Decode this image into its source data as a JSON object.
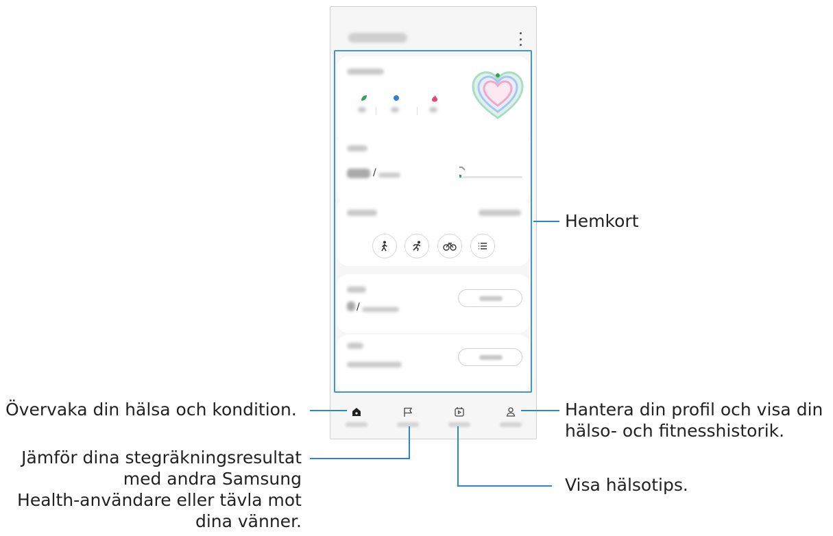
{
  "callouts": {
    "home_cards": "Hemkort",
    "monitor": "Övervaka din hälsa och kondition.",
    "compare": [
      "Jämför dina stegräkningsresultat",
      "med andra Samsung",
      "Health-användare eller tävla mot",
      "dina vänner."
    ],
    "profile": [
      "Hantera din profil och visa din",
      "hälso- och fitnesshistorik."
    ],
    "tips": "Visa hälsotips."
  },
  "phone": {
    "header_menu_icon": "more-vertical-icon",
    "cards": [
      {
        "id": "activity",
        "icons": [
          "leaf-icon",
          "dot-blue-icon",
          "flame-icon"
        ],
        "graphic": "heart-rings"
      },
      {
        "id": "steps",
        "separator": "/"
      },
      {
        "id": "exercise",
        "buttons": [
          "walk-icon",
          "run-icon",
          "bike-icon",
          "list-icon"
        ]
      },
      {
        "id": "food",
        "separator": "/",
        "has_button": true
      },
      {
        "id": "sleep",
        "has_button": true
      }
    ],
    "nav_icons": [
      "home-icon",
      "flag-icon",
      "calendar-play-icon",
      "person-icon"
    ]
  },
  "colors": {
    "highlight": "#3f94d6",
    "leader": "#2a87cc",
    "green": "#2fa35a",
    "blue": "#2f7fd6",
    "pink": "#e0457b"
  }
}
